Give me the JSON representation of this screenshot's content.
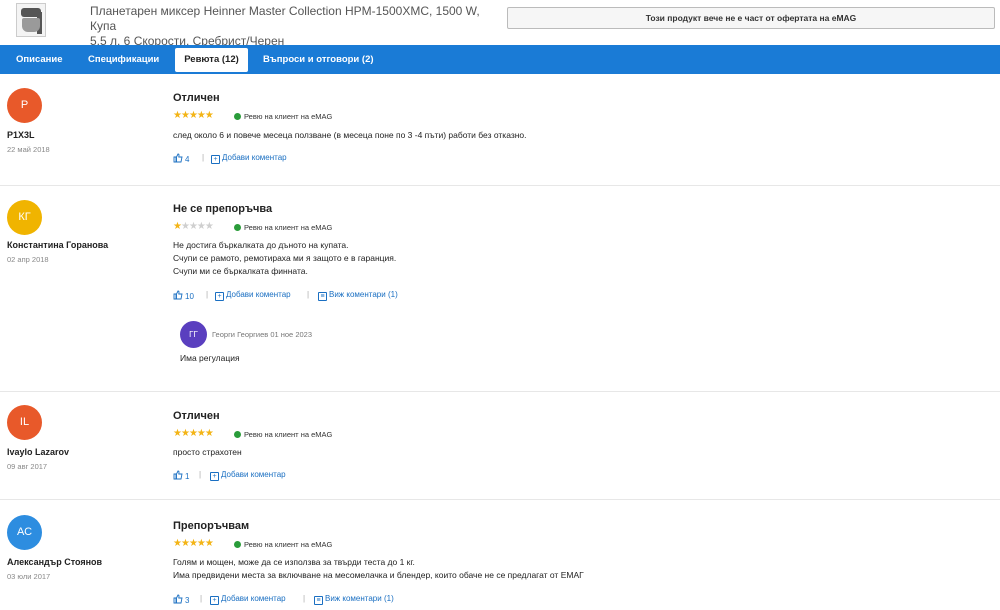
{
  "product": {
    "title_line1": "Планетарен миксер Heinner Master Collection HPM-1500XMC, 1500 W, Купа",
    "title_line2": "5.5 л, 6 Скорости, Сребрист/Черен",
    "unavailable_notice": "Този продукт вече не е част от офертата на eMAG"
  },
  "tabs": [
    {
      "label": "Описание"
    },
    {
      "label": "Спецификации"
    },
    {
      "label": "Ревюта (12)",
      "active": true
    },
    {
      "label": "Въпроси и отговори (2)"
    }
  ],
  "labels": {
    "verified": "Ревю на клиент на eMAG",
    "add_comment": "Добави коментар",
    "view_comments_prefix": "Виж коментари"
  },
  "reviews": [
    {
      "initials": "P",
      "avatar_color": "#e8592a",
      "author": "P1X3L",
      "date": "22 май 2018",
      "title": "Отличен",
      "stars": 5,
      "body": [
        "след около 6 и повече месеца ползване (в месеца поне по 3 -4 пъти) работи без отказно."
      ],
      "likes": "4"
    },
    {
      "initials": "КГ",
      "avatar_color": "#f0b400",
      "author": "Константина Горанова",
      "date": "02 апр 2018",
      "title": "Не се препоръчва",
      "stars": 1,
      "body": [
        "Не достига бъркалката до дъното на купата.",
        "Счупи се рамото, ремотираха ми я защото е в гаранция.",
        "Счупи ми се бъркалката финната."
      ],
      "likes": "10",
      "view_comments": "Виж коментари (1)",
      "comment": {
        "initials": "ГГ",
        "meta": "Георги Георгиев 01 ное 2023",
        "body": "Има регулация"
      }
    },
    {
      "initials": "IL",
      "avatar_color": "#e8592a",
      "author": "Ivaylo Lazarov",
      "date": "09 авг 2017",
      "title": "Отличен",
      "stars": 5,
      "body": [
        "просто страхотен"
      ],
      "likes": "1"
    },
    {
      "initials": "АС",
      "avatar_color": "#2d8de0",
      "author": "Александър Стоянов",
      "date": "03 юли 2017",
      "title": "Препоръчвам",
      "stars": 5,
      "body": [
        "Голям и мощен, може да се използва за твърди теста до 1 кг.",
        "Има предвидени места за включване на месомелачка и блендер, които обаче не се предлагат от ЕМАГ"
      ],
      "likes": "3",
      "view_comments": "Виж коментари (1)"
    }
  ]
}
